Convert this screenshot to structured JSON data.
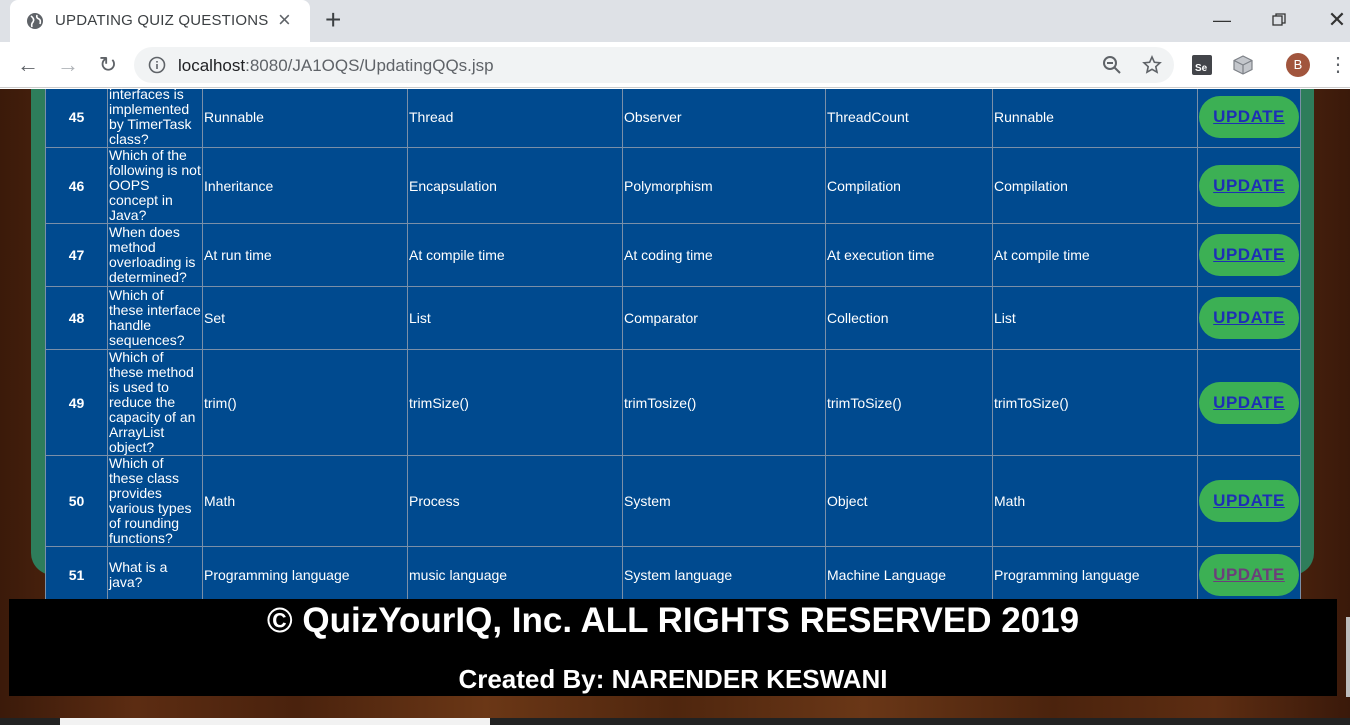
{
  "browser": {
    "tab_title": "UPDATING QUIZ QUESTIONS",
    "url_host": "localhost",
    "url_rest": ":8080/JA1OQS/UpdatingQQs.jsp",
    "profile_initial": "B"
  },
  "table": {
    "rows": [
      {
        "num": "45",
        "question": "interfaces is implemented by TimerTask class?",
        "o1": "Runnable",
        "o2": "Thread",
        "o3": "Observer",
        "o4": "ThreadCount",
        "answer": "Runnable"
      },
      {
        "num": "46",
        "question": "Which of the following is not OOPS concept in Java?",
        "o1": "Inheritance",
        "o2": "Encapsulation",
        "o3": "Polymorphism",
        "o4": "Compilation",
        "answer": "Compilation"
      },
      {
        "num": "47",
        "question": "When does method overloading is determined?",
        "o1": "At run time",
        "o2": "At compile time",
        "o3": "At coding time",
        "o4": "At execution time",
        "answer": "At compile time"
      },
      {
        "num": "48",
        "question": "Which of these interface handle sequences?",
        "o1": "Set",
        "o2": "List",
        "o3": "Comparator",
        "o4": "Collection",
        "answer": "List"
      },
      {
        "num": "49",
        "question": "Which of these method is used to reduce the capacity of an ArrayList object?",
        "o1": "trim()",
        "o2": "trimSize()",
        "o3": "trimTosize()",
        "o4": "trimToSize()",
        "answer": "trimToSize()"
      },
      {
        "num": "50",
        "question": "Which of these class provides various types of rounding functions?",
        "o1": "Math",
        "o2": "Process",
        "o3": "System",
        "o4": "Object",
        "answer": "Math"
      },
      {
        "num": "51",
        "question": "What is a java?",
        "o1": "Programming language",
        "o2": "music language",
        "o3": "System language",
        "o4": "Machine Language",
        "answer": "Programming language"
      }
    ],
    "update_label": "UPDATE"
  },
  "footer": {
    "copyright": "© QuizYourIQ, Inc. ALL RIGHTS RESERVED 2019",
    "created_by": "Created By: NARENDER KESWANI"
  }
}
